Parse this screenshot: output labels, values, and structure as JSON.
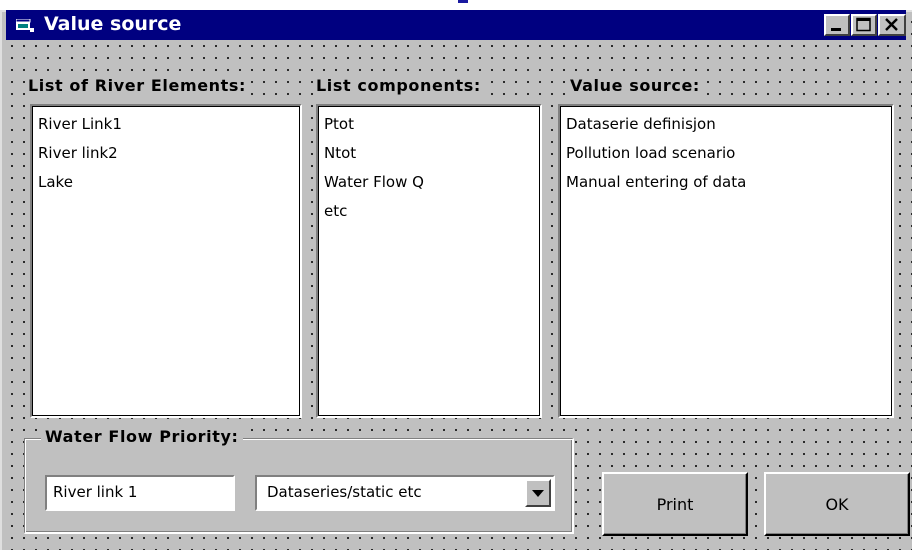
{
  "window": {
    "title": "Value source",
    "titlebar_color": "#000080",
    "face_color": "#c0c0c0"
  },
  "icons": {
    "app": "window-app-icon",
    "minimize": "minimize-icon",
    "maximize": "maximize-icon",
    "close": "close-icon",
    "dropdown": "chevron-down-icon"
  },
  "columns": [
    {
      "label": "List of River Elements:",
      "items": [
        "River Link1",
        "River link2",
        "Lake"
      ]
    },
    {
      "label": "List components:",
      "items": [
        "Ptot",
        "Ntot",
        "Water Flow Q",
        "etc"
      ]
    },
    {
      "label": "Value source:",
      "items": [
        "Dataserie definisjon",
        "Pollution load scenario",
        "Manual entering of data"
      ]
    }
  ],
  "water_flow": {
    "title": "Water Flow Priority:",
    "textbox_value": "River link 1",
    "combo_value": "Dataseries/static etc"
  },
  "buttons": {
    "print": "Print",
    "ok": "OK"
  }
}
